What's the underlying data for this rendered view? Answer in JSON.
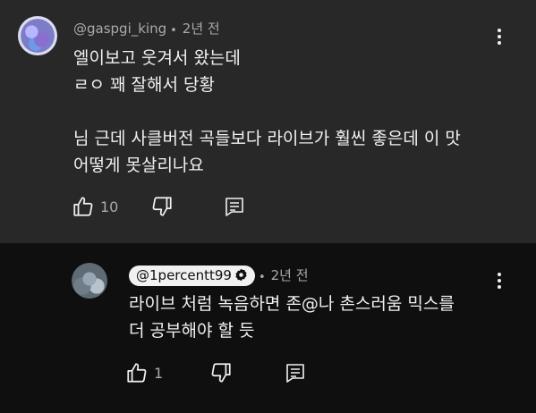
{
  "top_comment": {
    "author": "@gaspgi_king",
    "time": "2년 전",
    "body": "엘이보고 웃겨서 왔는데\nㄹㅇ 꽤 잘해서 당황\n\n님 근데 사클버전 곡들보다 라이브가 훨씬 좋은데 이 맛\n어떻게 못살리나요",
    "like_count": "10"
  },
  "reply_comment": {
    "author": "@1percentt99",
    "time": "2년 전",
    "body": "라이브 처럼 녹음하면 존@나 촌스러움 믹스를\n더 공부해야 할 듯",
    "like_count": "1"
  },
  "icons": {
    "like": "thumb-up-icon",
    "dislike": "thumb-down-icon",
    "reply": "reply-icon",
    "more": "more-vert-icon",
    "verified": "verified-badge-icon"
  },
  "colors": {
    "top_background": "#282828",
    "page_background": "#0f0f0f",
    "text": "#f1f1f1",
    "secondary_text": "#aaaaaa"
  }
}
